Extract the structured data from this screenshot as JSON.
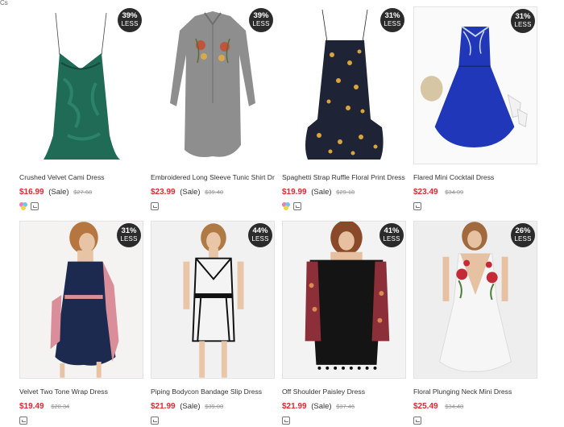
{
  "page": {
    "corner_label": "Cs"
  },
  "products": [
    {
      "discount": "39%",
      "less": "LESS",
      "title": "Crushed Velvet Cami Dress",
      "price": "$16.99",
      "sale": "(Sale)",
      "original_price": "$27.68",
      "has_color_icon": true,
      "dress_color": "#1f6b55"
    },
    {
      "discount": "39%",
      "less": "LESS",
      "title": "Embroidered Long Sleeve Tunic Shirt Dress",
      "price": "$23.99",
      "sale": "(Sale)",
      "original_price": "$39.40",
      "has_color_icon": false,
      "dress_color": "#8e8e8e"
    },
    {
      "discount": "31%",
      "less": "LESS",
      "title": "Spaghetti Strap Ruffle Floral Print Dress",
      "price": "$19.99",
      "sale": "(Sale)",
      "original_price": "$29.18",
      "has_color_icon": true,
      "dress_color": "#1e2336"
    },
    {
      "discount": "31%",
      "less": "LESS",
      "title": "Flared Mini Cocktail Dress",
      "price": "$23.49",
      "sale": "",
      "original_price": "$34.09",
      "has_color_icon": false,
      "dress_color": "#1f37b8"
    },
    {
      "discount": "31%",
      "less": "LESS",
      "title": "Velvet Two Tone Wrap Dress",
      "price": "$19.49",
      "sale": "",
      "original_price": "$28.34",
      "has_color_icon": false,
      "dress_color": "#1c2a4f"
    },
    {
      "discount": "44%",
      "less": "LESS",
      "title": "Piping Bodycon Bandage Slip Dress",
      "price": "$21.99",
      "sale": "(Sale)",
      "original_price": "$39.00",
      "has_color_icon": false,
      "dress_color": "#f4f4f4"
    },
    {
      "discount": "41%",
      "less": "LESS",
      "title": "Off Shoulder Paisley Dress",
      "price": "$21.99",
      "sale": "(Sale)",
      "original_price": "$37.46",
      "has_color_icon": false,
      "dress_color": "#141414"
    },
    {
      "discount": "26%",
      "less": "LESS",
      "title": "Floral Plunging Neck Mini Dress",
      "price": "$25.49",
      "sale": "",
      "original_price": "$34.48",
      "has_color_icon": false,
      "dress_color": "#f6f6f6"
    }
  ],
  "colors": {
    "price": "#e8252f",
    "badge": "#2b2b2b"
  }
}
